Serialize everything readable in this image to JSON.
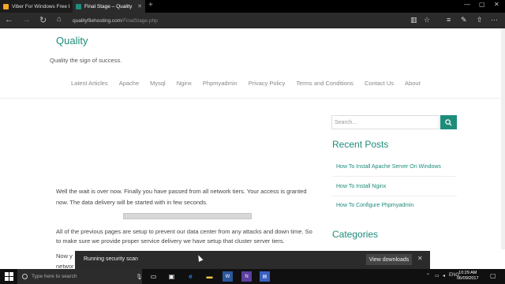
{
  "browser": {
    "tabs": [
      {
        "title": "Viber For Windows Free Do",
        "favicon_color": "#f5a623"
      },
      {
        "title": "Final Stage – Quality",
        "favicon_color": "#1e8c7b"
      }
    ],
    "url_domain": "qualityfilehosting.com",
    "url_path": "/FinalStage.php"
  },
  "site": {
    "title": "Quality",
    "tagline": "Quality the sign of success.",
    "menu": [
      "Latest Articles",
      "Apache",
      "Mysql",
      "Nginx",
      "Phpmyadmin",
      "Privacy Policy",
      "Terms and Conditions",
      "Contact Us",
      "About"
    ]
  },
  "content": {
    "paragraph1": "Well the wait is over now. Finally you have passed from all network tiers. Your access is granted now. The data delivery will be started with in few seconds.",
    "progress_fraction": 0.0,
    "paragraph2": "All of the previous pages are setup to prevent our data center from any attacks and down time. So to make sure we provide proper service delivery we have setup that cluster server tiers.",
    "paragraph3_visible": "Now y",
    "paragraph3_line2": "networ"
  },
  "sidebar": {
    "search_placeholder": "Search...",
    "recent_heading": "Recent Posts",
    "recent_posts": [
      "How To Install Apache Server On Windows",
      "How To Install Nginx",
      "How To Configure Phpmyadmin"
    ],
    "categories_heading": "Categories"
  },
  "download_bar": {
    "status": "Running security scan",
    "button": "View downloads"
  },
  "taskbar": {
    "search_placeholder": "Type here to search",
    "lang": "ENG",
    "time": "10:29 AM",
    "date": "06/09/2017"
  },
  "colors": {
    "accent": "#1e8c7b"
  }
}
